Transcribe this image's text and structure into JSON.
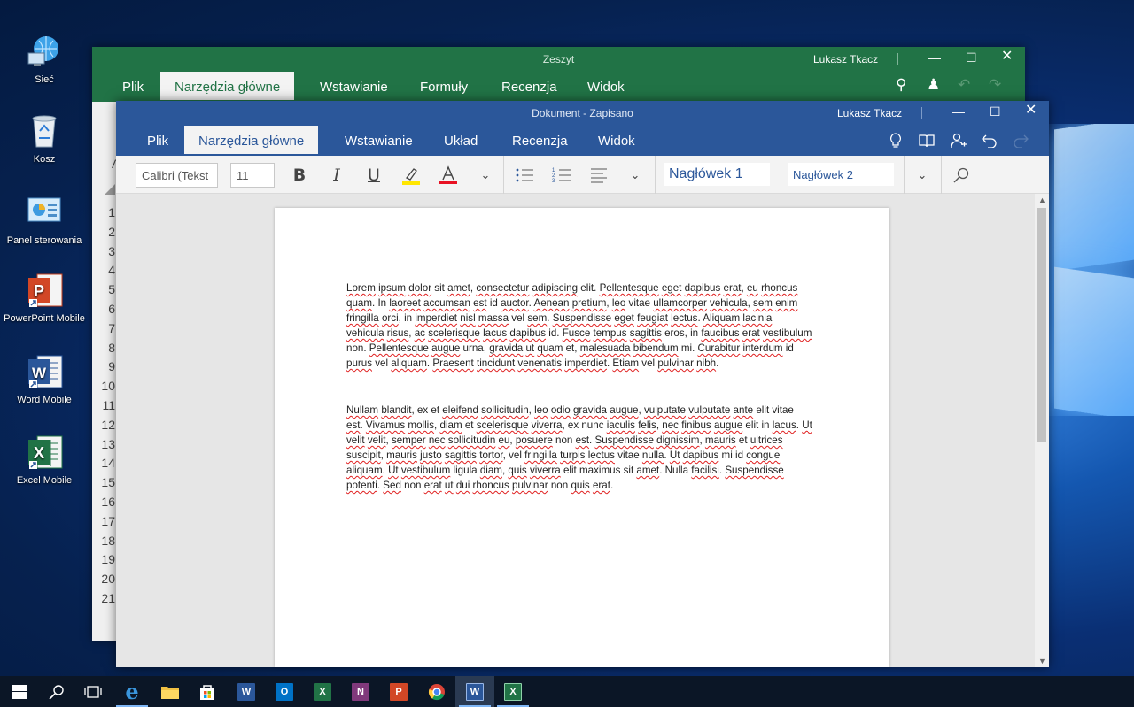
{
  "desktop": {
    "icons": [
      {
        "label": "Sieć",
        "icon": "network-globe-icon"
      },
      {
        "label": "Kosz",
        "icon": "recycle-bin-icon"
      },
      {
        "label": "Panel sterowania",
        "icon": "control-panel-icon"
      },
      {
        "label": "PowerPoint Mobile",
        "icon": "powerpoint-icon"
      },
      {
        "label": "Word Mobile",
        "icon": "word-icon"
      },
      {
        "label": "Excel Mobile",
        "icon": "excel-icon"
      }
    ]
  },
  "excel_window": {
    "title": "Zeszyt",
    "user": "Lukasz Tkacz",
    "tabs": [
      "Plik",
      "Narzędzia główne",
      "Wstawianie",
      "Formuły",
      "Recenzja",
      "Widok"
    ],
    "selected_tab": "Narzędzia główne",
    "column_letter": "A",
    "row_numbers": [
      "1",
      "2",
      "3",
      "4",
      "5",
      "6",
      "7",
      "8",
      "9",
      "10",
      "11",
      "12",
      "13",
      "14",
      "15",
      "16",
      "17",
      "18",
      "19",
      "20",
      "21"
    ],
    "accent": "#217346"
  },
  "word_window": {
    "title": "Dokument - Zapisano",
    "user": "Lukasz Tkacz",
    "tabs": [
      "Plik",
      "Narzędzia główne",
      "Wstawianie",
      "Układ",
      "Recenzja",
      "Widok"
    ],
    "selected_tab": "Narzędzia główne",
    "font_name": "Calibri (Tekst",
    "font_size": "11",
    "styles": [
      "Nagłówek 1",
      "Nagłówek 2"
    ],
    "accent": "#2b579a",
    "document": {
      "paragraph1": [
        "Lorem ipsum dolor sit amet, consectetur adipiscing elit. Pellentesque eget dapibus erat, eu rhoncus",
        "quam. In laoreet accumsan est id auctor. Aenean pretium, leo vitae ullamcorper vehicula, sem enim",
        "fringilla orci, in imperdiet nisl massa vel sem. Suspendisse eget feugiat lectus. Aliquam lacinia",
        "vehicula risus, ac scelerisque lacus dapibus id. Fusce tempus sagittis eros, in faucibus erat vestibulum",
        "non. Pellentesque augue urna, gravida ut quam et, malesuada bibendum mi. Curabitur interdum id",
        "purus vel aliquam. Praesent tincidunt venenatis imperdiet. Etiam vel pulvinar nibh."
      ],
      "paragraph2": [
        "Nullam blandit, ex et eleifend sollicitudin, leo odio gravida augue, vulputate vulputate ante elit vitae",
        "est. Vivamus mollis, diam et scelerisque viverra, ex nunc iaculis felis, nec finibus augue elit in lacus. Ut",
        "velit velit, semper nec sollicitudin eu, posuere non est. Suspendisse dignissim, mauris et ultrices",
        "suscipit, mauris justo sagittis tortor, vel fringilla turpis lectus vitae nulla. Ut dapibus mi id congue",
        "aliquam. Ut vestibulum ligula diam, quis viverra elit maximus sit amet. Nulla facilisi. Suspendisse",
        "potenti. Sed non erat ut dui rhoncus pulvinar non quis erat."
      ]
    }
  },
  "taskbar": {
    "items": [
      "start-icon",
      "search-icon",
      "task-view-icon",
      "edge-icon",
      "file-explorer-icon",
      "store-icon",
      "word-icon",
      "outlook-icon",
      "excel-icon",
      "onenote-icon",
      "powerpoint-icon",
      "chrome-icon",
      "word-mobile-icon",
      "excel-mobile-icon"
    ],
    "app_letters": {
      "word": "W",
      "outlook": "O",
      "excel": "X",
      "onenote": "N",
      "powerpoint": "P",
      "edge": "e"
    }
  }
}
